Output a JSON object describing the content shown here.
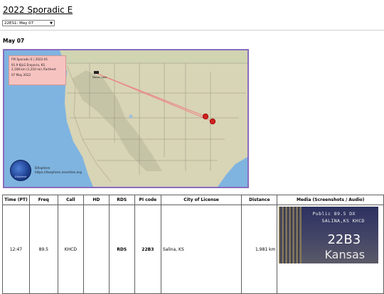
{
  "page": {
    "title": "2022 Sporadic E",
    "select_value": "22ES1: May 07",
    "section_date": "May 07"
  },
  "map": {
    "infobox": {
      "line1": "FM Sporadic E  |  2022-01",
      "line2": "91.9 KJLG Emporia, KS",
      "line3": "2,108 km (1,310 mi) /Farthest",
      "line4": "07 May 2022"
    },
    "home_label": "Moses Lake",
    "logo": {
      "badge_text": "DXsphere",
      "name": "DXsphere",
      "url": "https://dxsphere.neocities.org"
    },
    "colors": {
      "ocean": "#7fb4e0",
      "land": "#d8d4b6",
      "path_line": "#e88a86",
      "marker": "#d11f1f",
      "frame": "#8a6bbd"
    }
  },
  "table": {
    "headers": [
      "Time (PT)",
      "Freq",
      "Call",
      "HD",
      "RDS",
      "PI code",
      "City of License",
      "Distance",
      "Media (Screenshots / Audio)"
    ],
    "rows": [
      {
        "time": "12:47",
        "freq": "89.5",
        "call": "KHCD",
        "hd": "",
        "rds": "RDS",
        "pi": "22B3",
        "city": "Salina, KS",
        "distance": "1,981 km",
        "media": {
          "line1": "Public  89.5  DX",
          "line2": "SALINA,KS  KHCD",
          "big": "22B3",
          "big2": "Kansas"
        }
      }
    ]
  }
}
